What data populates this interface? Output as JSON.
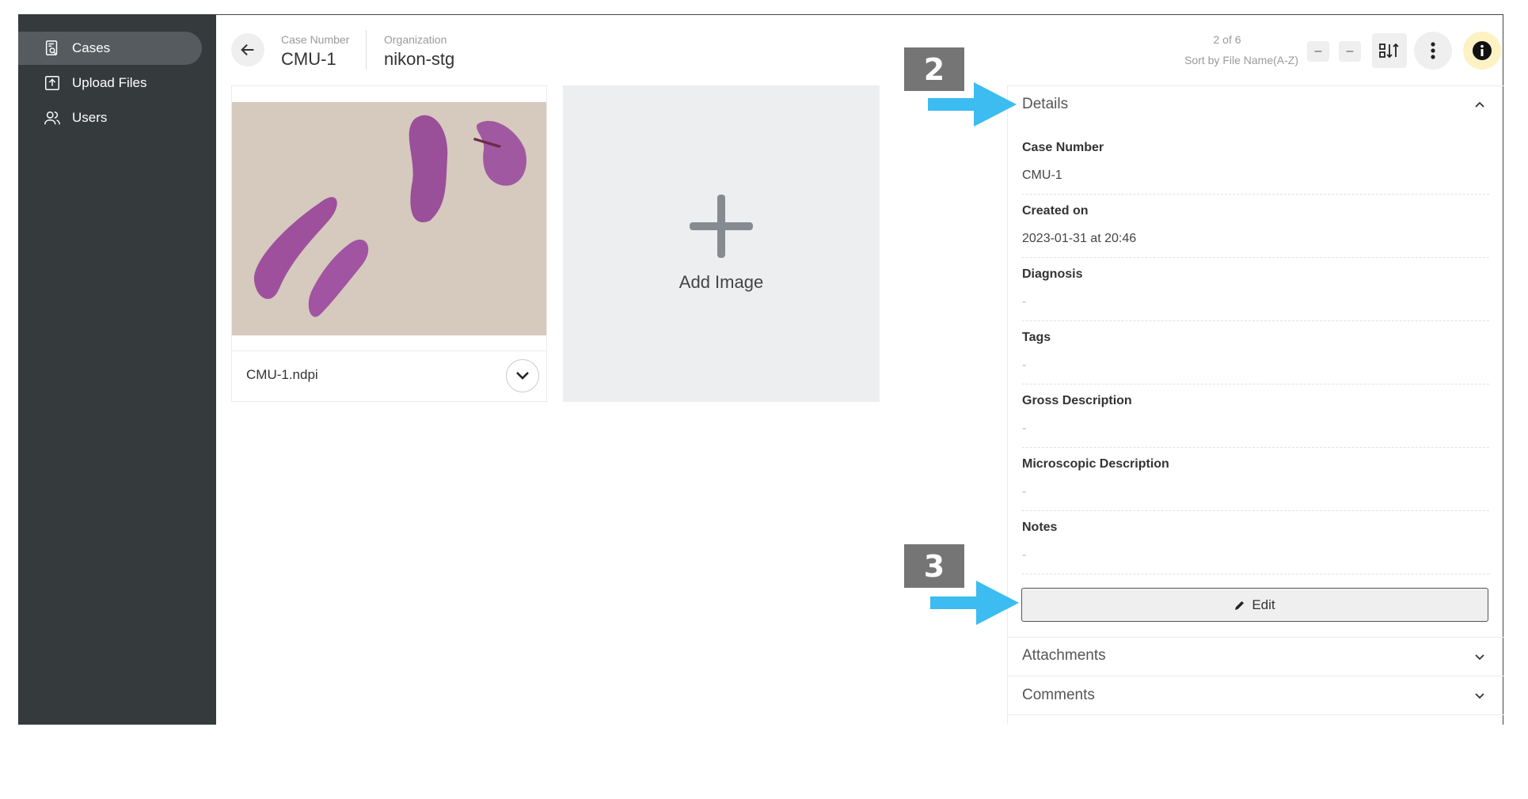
{
  "sidebar": {
    "items": [
      {
        "label": "Cases",
        "icon": "case-search-icon",
        "active": true
      },
      {
        "label": "Upload Files",
        "icon": "upload-icon",
        "active": false
      },
      {
        "label": "Users",
        "icon": "users-icon",
        "active": false
      }
    ]
  },
  "header": {
    "case_number_label": "Case Number",
    "case_number": "CMU-1",
    "organization_label": "Organization",
    "organization": "nikon-stg"
  },
  "toolbar": {
    "pager": "2 of 6",
    "sort_label": "Sort by File Name(A-Z)",
    "minus1": "–",
    "minus2": "–"
  },
  "images": [
    {
      "filename": "CMU-1.ndpi"
    }
  ],
  "add_image": {
    "label": "Add Image"
  },
  "details": {
    "title": "Details",
    "fields": [
      {
        "label": "Case Number",
        "value": "CMU-1"
      },
      {
        "label": "Created on",
        "value": "2023-01-31 at 20:46"
      },
      {
        "label": "Diagnosis",
        "value": "-"
      },
      {
        "label": "Tags",
        "value": "-"
      },
      {
        "label": "Gross Description",
        "value": "-"
      },
      {
        "label": "Microscopic Description",
        "value": "-"
      },
      {
        "label": "Notes",
        "value": "-"
      }
    ],
    "edit_label": "Edit"
  },
  "sections": {
    "attachments": "Attachments",
    "comments": "Comments"
  },
  "annotations": {
    "badge1": "2",
    "badge2": "3",
    "arrow_color": "#3cbcf0"
  },
  "colors": {
    "sidebar_bg": "#353a3d",
    "active_item_bg": "#555b5f",
    "info_button_bg": "#fdf2c4"
  }
}
